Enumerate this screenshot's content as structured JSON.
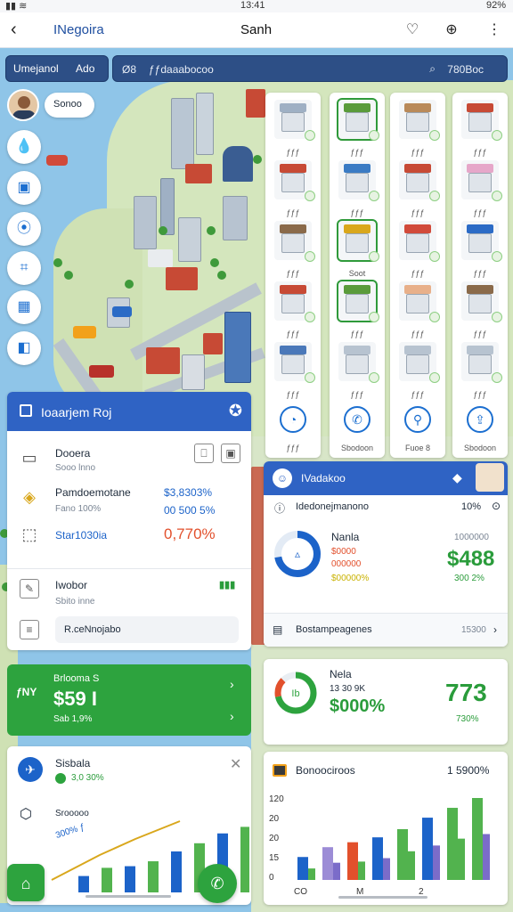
{
  "status": {
    "time": "13:41",
    "battery": "92%"
  },
  "header": {
    "title": "INegoira",
    "center_title": "Sanh"
  },
  "map_search": {
    "left_label": "Umejanol",
    "left_sub": "Ado",
    "right_left": "Ø8",
    "right_mid": "ƒƒdaaabocoo",
    "right_right": "780Boc"
  },
  "avatar_tooltip": "Sonoo",
  "buildings": {
    "col1": [
      "ƒƒƒ",
      "ƒƒƒ",
      "ƒƒƒ",
      "ƒƒƒ",
      "ƒƒƒ",
      "ƒƒƒ"
    ],
    "col2": [
      "ƒƒƒ",
      "ƒƒƒ",
      "Soot",
      "ƒƒƒ",
      "ƒƒƒ",
      "Sbodoon"
    ],
    "col3": [
      "ƒƒƒ",
      "ƒƒƒ",
      "ƒƒƒ",
      "ƒƒƒ",
      "ƒƒƒ",
      "Fuoe 8"
    ],
    "col4": [
      "ƒƒƒ",
      "ƒƒƒ",
      "ƒƒƒ",
      "ƒƒƒ",
      "ƒƒƒ",
      "Sbodoon"
    ]
  },
  "left_panel": {
    "title": "Ioaarjem Roj",
    "row1": {
      "title": "Dooera",
      "sub": "Sooo lnno"
    },
    "row2": {
      "title": "Pamdoemotane",
      "sub": "Fano 100%",
      "v1": "$3,8303%",
      "v2": "00 500 5%"
    },
    "row3": {
      "title": "Star1030ia",
      "v1": "0,770%"
    },
    "row4": {
      "title": "Iwobor",
      "sub": "Sbito inne"
    },
    "row5": {
      "title": "R.ceNnojabo"
    }
  },
  "green_card": {
    "label": "Brlooma S",
    "value": "$59 I",
    "sub": "Sab 1,9%",
    "left": "ƒNY"
  },
  "chart_card_left": {
    "title": "Sisbala",
    "sub": "3,0 30%",
    "label": "Srooooo",
    "value": "300% ƒ"
  },
  "right_panel": {
    "title": "IVadakoo",
    "sub_title": "Idedonejmanono",
    "sub_value": "10%",
    "row_title": "Nanla",
    "row_l1": "$0000",
    "row_l2": "000000",
    "row_l3": "$00000%",
    "row_value": "$488",
    "row_r1": "1000000",
    "row_r2": "300 2%",
    "footer": "Bostampeagenes",
    "footer_value": "15300"
  },
  "stat_card": {
    "title": "Nela",
    "l1": "13 30 9K",
    "value": "$000%",
    "big": "773",
    "r1": "730%"
  },
  "chart_card_right": {
    "title": "Bonoociroos",
    "value": "1 5900%"
  },
  "chart_data": {
    "type": "bar",
    "series": [
      {
        "values": [
          20,
          30,
          32,
          38,
          50,
          60,
          72,
          80
        ]
      },
      {
        "values": [
          28,
          40,
          46,
          52,
          62,
          76,
          88,
          100
        ]
      }
    ],
    "ylabels": [
      "120",
      "20",
      "20",
      "15",
      "0"
    ],
    "xlabels": [
      "CO",
      "M",
      "2"
    ]
  },
  "colors": {
    "primary": "#2f63c4",
    "green": "#2da33e",
    "red": "#e2502c"
  }
}
